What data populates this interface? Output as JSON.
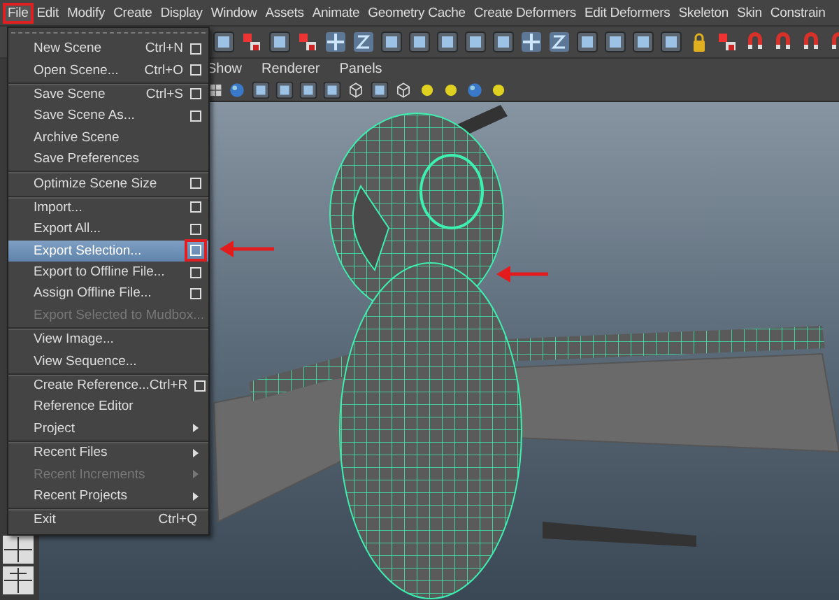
{
  "menubar": [
    {
      "label": "File",
      "selected": true,
      "highlighted": true
    },
    {
      "label": "Edit",
      "selected": false,
      "highlighted": false
    },
    {
      "label": "Modify",
      "selected": false,
      "highlighted": false
    },
    {
      "label": "Create",
      "selected": false,
      "highlighted": false
    },
    {
      "label": "Display",
      "selected": false,
      "highlighted": false
    },
    {
      "label": "Window",
      "selected": false,
      "highlighted": false
    },
    {
      "label": "Assets",
      "selected": false,
      "highlighted": false
    },
    {
      "label": "Animate",
      "selected": false,
      "highlighted": false
    },
    {
      "label": "Geometry Cache",
      "selected": false,
      "highlighted": false
    },
    {
      "label": "Create Deformers",
      "selected": false,
      "highlighted": false
    },
    {
      "label": "Edit Deformers",
      "selected": false,
      "highlighted": false
    },
    {
      "label": "Skeleton",
      "selected": false,
      "highlighted": false
    },
    {
      "label": "Skin",
      "selected": false,
      "highlighted": false
    },
    {
      "label": "Constrain",
      "selected": false,
      "highlighted": false
    }
  ],
  "file_menu": [
    {
      "label": "New Scene",
      "shortcut": "Ctrl+N",
      "option_box": true,
      "submenu": false,
      "disabled": false,
      "selected": false,
      "separator_before": false
    },
    {
      "label": "Open Scene...",
      "shortcut": "Ctrl+O",
      "option_box": true,
      "submenu": false,
      "disabled": false,
      "selected": false,
      "separator_before": false
    },
    {
      "label": "Save Scene",
      "shortcut": "Ctrl+S",
      "option_box": true,
      "submenu": false,
      "disabled": false,
      "selected": false,
      "separator_before": true
    },
    {
      "label": "Save Scene As...",
      "option_box": true,
      "submenu": false,
      "disabled": false,
      "selected": false,
      "separator_before": false
    },
    {
      "label": "Archive Scene",
      "option_box": false,
      "submenu": false,
      "disabled": false,
      "selected": false,
      "separator_before": false
    },
    {
      "label": "Save Preferences",
      "option_box": false,
      "submenu": false,
      "disabled": false,
      "selected": false,
      "separator_before": false
    },
    {
      "label": "Optimize Scene Size",
      "option_box": true,
      "submenu": false,
      "disabled": false,
      "selected": false,
      "separator_before": true
    },
    {
      "label": "Import...",
      "option_box": true,
      "submenu": false,
      "disabled": false,
      "selected": false,
      "separator_before": true
    },
    {
      "label": "Export All...",
      "option_box": true,
      "submenu": false,
      "disabled": false,
      "selected": false,
      "separator_before": false
    },
    {
      "label": "Export Selection...",
      "option_box": true,
      "submenu": false,
      "disabled": false,
      "selected": true,
      "separator_before": false,
      "option_highlighted": true
    },
    {
      "label": "Export to Offline File...",
      "option_box": true,
      "submenu": false,
      "disabled": false,
      "selected": false,
      "separator_before": false
    },
    {
      "label": "Assign Offline File...",
      "option_box": true,
      "submenu": false,
      "disabled": false,
      "selected": false,
      "separator_before": false
    },
    {
      "label": "Export Selected to Mudbox...",
      "option_box": false,
      "submenu": false,
      "disabled": true,
      "selected": false,
      "separator_before": false
    },
    {
      "label": "View Image...",
      "option_box": false,
      "submenu": false,
      "disabled": false,
      "selected": false,
      "separator_before": true
    },
    {
      "label": "View Sequence...",
      "option_box": false,
      "submenu": false,
      "disabled": false,
      "selected": false,
      "separator_before": false
    },
    {
      "label": "Create Reference...",
      "shortcut": "Ctrl+R",
      "option_box": true,
      "submenu": false,
      "disabled": false,
      "selected": false,
      "separator_before": true
    },
    {
      "label": "Reference Editor",
      "option_box": false,
      "submenu": false,
      "disabled": false,
      "selected": false,
      "separator_before": false
    },
    {
      "label": "Project",
      "option_box": false,
      "submenu": true,
      "disabled": false,
      "selected": false,
      "separator_before": false
    },
    {
      "label": "Recent Files",
      "option_box": false,
      "submenu": true,
      "disabled": false,
      "selected": false,
      "separator_before": true
    },
    {
      "label": "Recent Increments",
      "option_box": false,
      "submenu": true,
      "disabled": true,
      "selected": false,
      "separator_before": false
    },
    {
      "label": "Recent Projects",
      "option_box": false,
      "submenu": true,
      "disabled": false,
      "selected": false,
      "separator_before": false
    },
    {
      "label": "Exit",
      "shortcut": "Ctrl+Q",
      "option_box": false,
      "submenu": false,
      "disabled": false,
      "selected": false,
      "separator_before": true
    }
  ],
  "panel_menu": [
    "Show",
    "Renderer",
    "Panels"
  ]
}
